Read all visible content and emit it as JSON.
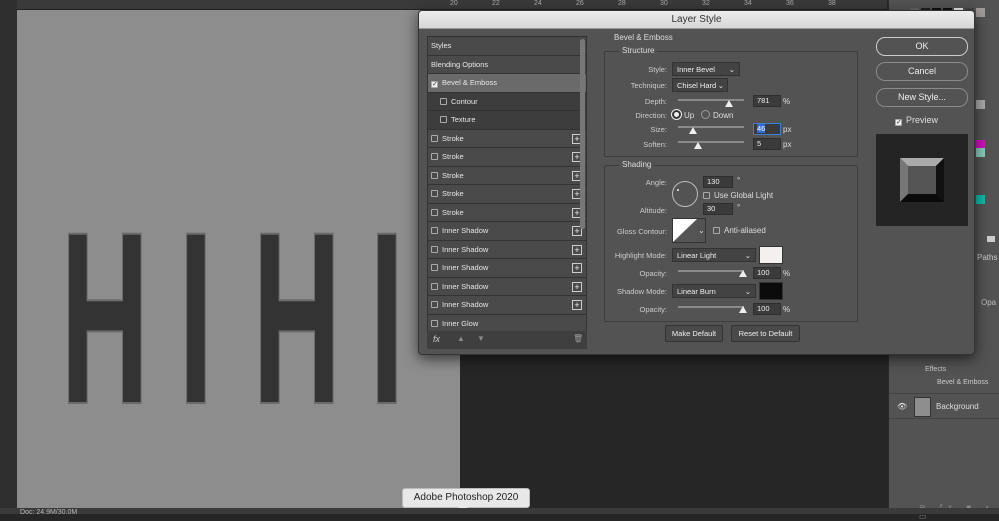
{
  "window": {
    "tooltip": "Adobe Photoshop 2020",
    "status": "Doc: 24.9M/30.0M"
  },
  "ruler": [
    "20",
    "22",
    "24",
    "26",
    "28",
    "30",
    "32",
    "34",
    "36",
    "38"
  ],
  "canvas": {
    "text": "HIHI"
  },
  "dialog": {
    "title": "Layer Style",
    "list": [
      {
        "label": "Styles",
        "type": "header"
      },
      {
        "label": "Blending Options",
        "type": "header"
      },
      {
        "label": "Bevel & Emboss",
        "checked": true,
        "selected": true
      },
      {
        "label": "Contour",
        "sub": true,
        "checked": false
      },
      {
        "label": "Texture",
        "sub": true,
        "checked": false
      },
      {
        "label": "Stroke",
        "plus": true
      },
      {
        "label": "Stroke",
        "plus": true
      },
      {
        "label": "Stroke",
        "plus": true
      },
      {
        "label": "Stroke",
        "plus": true
      },
      {
        "label": "Stroke",
        "plus": true
      },
      {
        "label": "Inner Shadow",
        "plus": true
      },
      {
        "label": "Inner Shadow",
        "plus": true
      },
      {
        "label": "Inner Shadow",
        "plus": true
      },
      {
        "label": "Inner Shadow",
        "plus": true
      },
      {
        "label": "Inner Shadow",
        "plus": true
      },
      {
        "label": "Inner Glow"
      }
    ],
    "fx_label": "fx",
    "section": "Bevel & Emboss",
    "structure": {
      "title": "Structure",
      "style_label": "Style:",
      "style": "Inner Bevel",
      "technique_label": "Technique:",
      "technique": "Chisel Hard",
      "depth_label": "Depth:",
      "depth": "781",
      "depth_unit": "%",
      "depth_pct": 78,
      "direction_label": "Direction:",
      "up": "Up",
      "down": "Down",
      "direction": "Up",
      "size_label": "Size:",
      "size": "46",
      "size_unit": "px",
      "size_pct": 22,
      "soften_label": "Soften:",
      "soften": "5",
      "soften_unit": "px",
      "soften_pct": 30
    },
    "shading": {
      "title": "Shading",
      "angle_label": "Angle:",
      "angle": "130",
      "deg": "°",
      "global_light": "Use Global Light",
      "altitude_label": "Altitude:",
      "altitude": "30",
      "gloss_label": "Gloss Contour:",
      "anti_aliased": "Anti-aliased",
      "highlight_label": "Highlight Mode:",
      "highlight_mode": "Linear Light",
      "highlight_color": "#f4f0f0",
      "opacity_label": "Opacity:",
      "highlight_opacity": "100",
      "pct": "%",
      "shadow_label": "Shadow Mode:",
      "shadow_mode": "Linear Burn",
      "shadow_color": "#0c0b0b",
      "shadow_opacity": "100"
    },
    "make_default": "Make Default",
    "reset_default": "Reset to Default",
    "ok": "OK",
    "cancel": "Cancel",
    "new_style": "New Style...",
    "preview": "Preview",
    "preview_checked": true
  },
  "layers": {
    "tab": "Paths",
    "opacity_label": "Opa",
    "effects": "Effects",
    "effect_item": "Bevel & Emboss",
    "background": "Background"
  }
}
